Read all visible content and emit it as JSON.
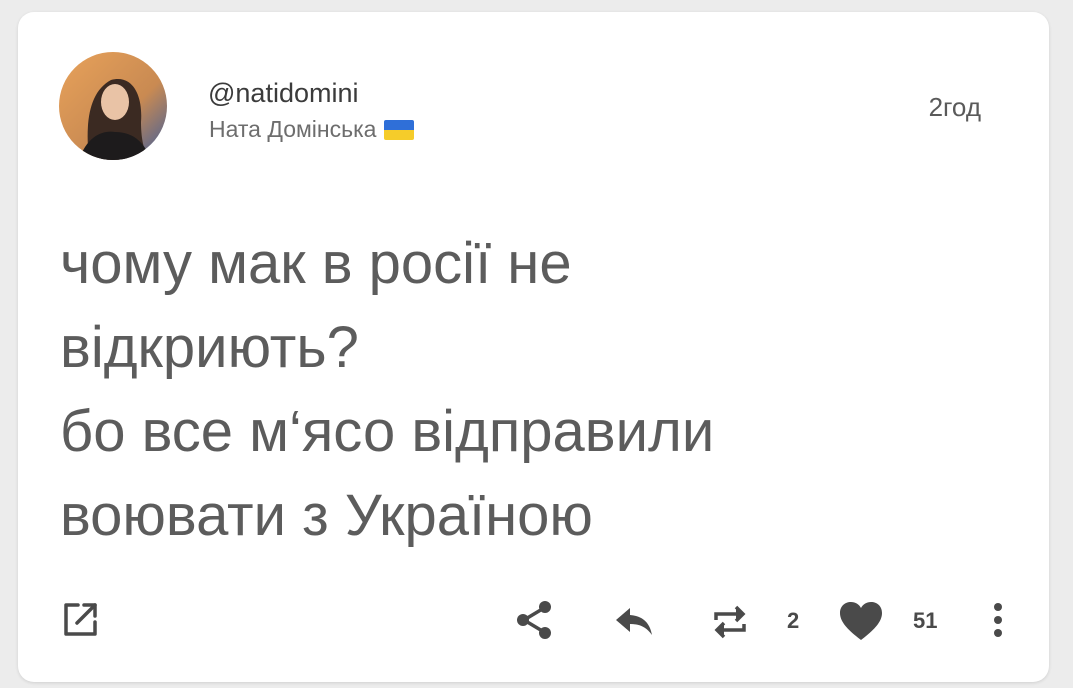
{
  "post": {
    "handle": "@natidomini",
    "display_name": "Ната Домінська",
    "time": "2год",
    "lines": [
      "чому мак в росії не",
      "відкриють?",
      "бо все м‘ясо відправили",
      "воювати з Україною"
    ]
  },
  "actions": {
    "open_icon": "open-external-icon",
    "share_icon": "share-icon",
    "reply_icon": "reply-icon",
    "repost_icon": "repost-icon",
    "repost_count": "2",
    "like_icon": "heart-icon",
    "like_count": "51",
    "more_icon": "more-vertical-icon"
  },
  "colors": {
    "flag_blue": "#2f6fd8",
    "flag_yellow": "#f5cc2a",
    "text": "#5c5c5c",
    "icon": "#4a4a4a"
  }
}
